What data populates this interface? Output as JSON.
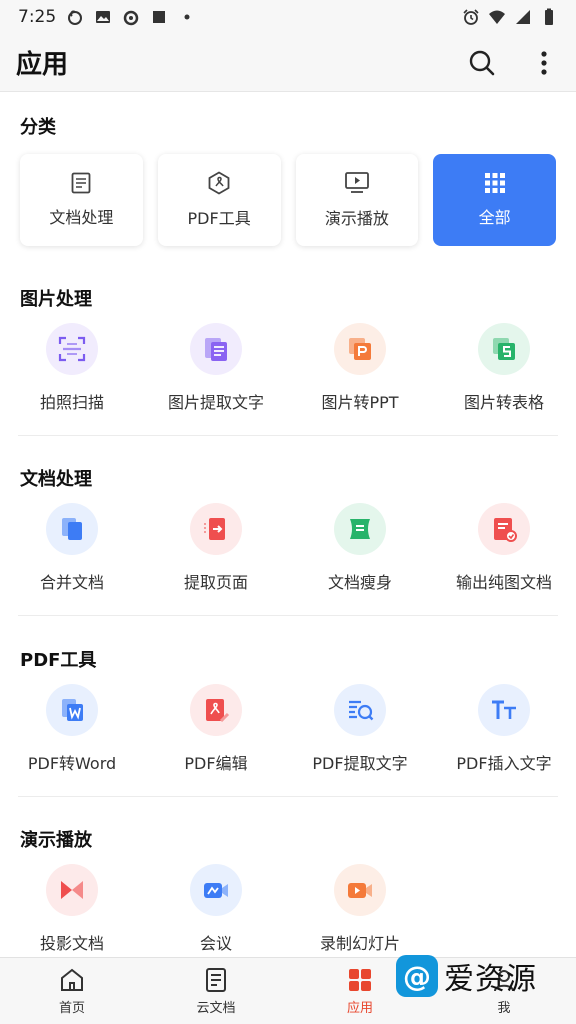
{
  "status": {
    "time": "7:25"
  },
  "appbar": {
    "title": "应用"
  },
  "categories": {
    "title": "分类",
    "items": [
      {
        "label": "文档处理",
        "icon": "document-icon"
      },
      {
        "label": "PDF工具",
        "icon": "pdf-icon"
      },
      {
        "label": "演示播放",
        "icon": "presentation-icon"
      },
      {
        "label": "全部",
        "icon": "grid-icon"
      }
    ]
  },
  "image_tools": {
    "title": "图片处理",
    "items": [
      {
        "label": "拍照扫描",
        "color": "#7c5cf0"
      },
      {
        "label": "图片提取文字",
        "color": "#8a63f2"
      },
      {
        "label": "图片转PPT",
        "color": "#f47a3a"
      },
      {
        "label": "图片转表格",
        "color": "#27b36a"
      }
    ]
  },
  "doc_tools": {
    "title": "文档处理",
    "items": [
      {
        "label": "合并文档",
        "color": "#3d7cf5"
      },
      {
        "label": "提取页面",
        "color": "#ef4f4f"
      },
      {
        "label": "文档瘦身",
        "color": "#27b36a"
      },
      {
        "label": "输出纯图文档",
        "color": "#ef4f4f"
      }
    ]
  },
  "pdf_tools": {
    "title": "PDF工具",
    "items": [
      {
        "label": "PDF转Word",
        "color": "#3d7cf5"
      },
      {
        "label": "PDF编辑",
        "color": "#ef4f4f"
      },
      {
        "label": "PDF提取文字",
        "color": "#3d7cf5"
      },
      {
        "label": "PDF插入文字",
        "color": "#3d7cf5"
      }
    ]
  },
  "present_tools": {
    "title": "演示播放",
    "items": [
      {
        "label": "投影文档",
        "color": "#ef4f4f"
      },
      {
        "label": "会议",
        "color": "#3d7cf5"
      },
      {
        "label": "录制幻灯片",
        "color": "#f47a3a"
      }
    ]
  },
  "tabs": [
    {
      "label": "首页"
    },
    {
      "label": "云文档"
    },
    {
      "label": "应用"
    },
    {
      "label": "我"
    }
  ],
  "watermark": {
    "text": "爱资源"
  }
}
